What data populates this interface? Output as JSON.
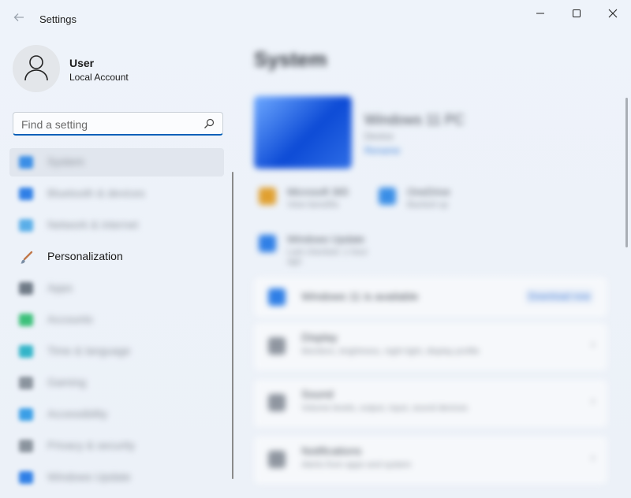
{
  "window": {
    "title": "Settings"
  },
  "user": {
    "name": "User",
    "account_type": "Local Account"
  },
  "search": {
    "placeholder": "Find a setting"
  },
  "nav": {
    "items": [
      {
        "label": "System",
        "icon": "system-icon",
        "color": "#3a8ee6",
        "selected": true,
        "blurred": true
      },
      {
        "label": "Bluetooth & devices",
        "icon": "bluetooth-icon",
        "color": "#2f7fe6",
        "blurred": true
      },
      {
        "label": "Network & internet",
        "icon": "network-icon",
        "color": "#5aaee8",
        "blurred": true
      },
      {
        "label": "Personalization",
        "icon": "paintbrush-icon",
        "color": "#c0784a",
        "blurred": false
      },
      {
        "label": "Apps",
        "icon": "apps-icon",
        "color": "#6f7a86",
        "blurred": true
      },
      {
        "label": "Accounts",
        "icon": "accounts-icon",
        "color": "#3cc07a",
        "blurred": true
      },
      {
        "label": "Time & language",
        "icon": "globe-icon",
        "color": "#32b4c8",
        "blurred": true
      },
      {
        "label": "Gaming",
        "icon": "gaming-icon",
        "color": "#8a939d",
        "blurred": true
      },
      {
        "label": "Accessibility",
        "icon": "accessibility-icon",
        "color": "#3a9ee6",
        "blurred": true
      },
      {
        "label": "Privacy & security",
        "icon": "shield-icon",
        "color": "#8a939d",
        "blurred": true
      },
      {
        "label": "Windows Update",
        "icon": "update-icon",
        "color": "#2f7fe6",
        "blurred": true
      }
    ]
  },
  "main": {
    "title": "System",
    "device": {
      "name": "Windows 11 PC",
      "sub": "Device",
      "link": "Rename"
    },
    "tiles": [
      {
        "title": "Microsoft 365",
        "sub": "View benefits",
        "icon": "office-icon",
        "color": "#e0a030"
      },
      {
        "title": "OneDrive",
        "sub": "Backed up",
        "icon": "onedrive-icon",
        "color": "#3a8ee6"
      },
      {
        "title": "Windows Update",
        "sub": "Last checked: 1 hour ago",
        "icon": "update-icon",
        "color": "#2f7fe6"
      }
    ],
    "banner": {
      "title": "Windows 11 is available",
      "button": "Download now"
    },
    "cards": [
      {
        "title": "Display",
        "sub": "Monitors, brightness, night light, display profile"
      },
      {
        "title": "Sound",
        "sub": "Volume levels, output, input, sound devices"
      },
      {
        "title": "Notifications",
        "sub": "Alerts from apps and system"
      }
    ]
  }
}
